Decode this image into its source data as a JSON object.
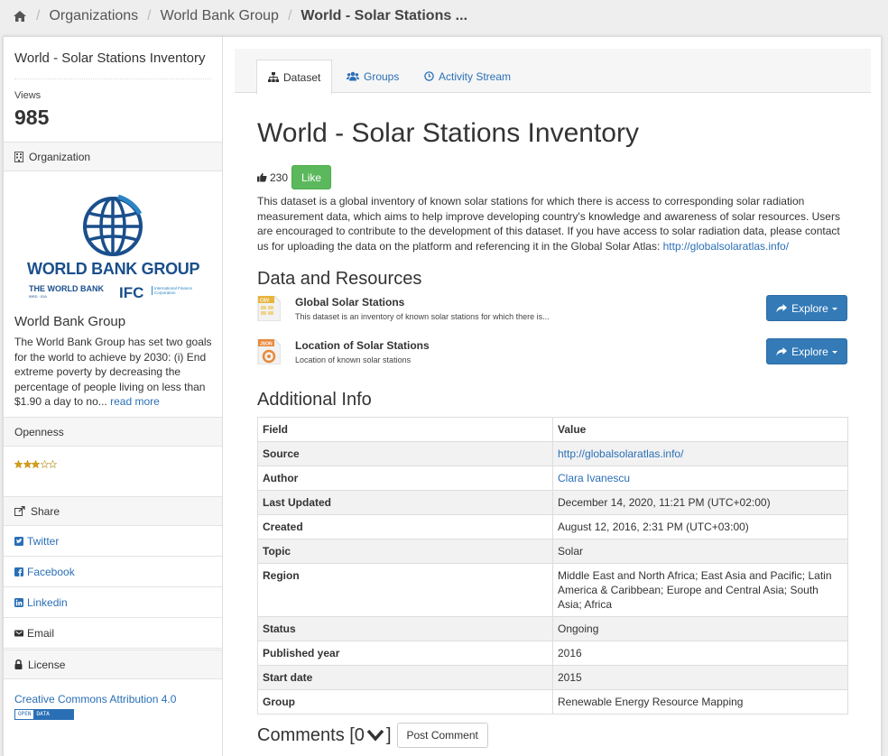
{
  "breadcrumb": {
    "items": [
      "Organizations",
      "World Bank Group"
    ],
    "current": "World - Solar Stations ..."
  },
  "sidebar": {
    "title": "World - Solar Stations Inventory",
    "views_label": "Views",
    "views_count": "985",
    "organization_heading": "Organization",
    "org_logo_text": [
      "WORLD BANK GROUP",
      "THE WORLD BANK",
      "IBRD · IDA",
      "IFC",
      "International Finance Corporation"
    ],
    "org_name": "World Bank Group",
    "org_description": "The World Bank Group has set two goals for the world to achieve by 2030: (i) End extreme poverty by decreasing the percentage of people living on less than $1.90 a day to no...",
    "read_more": "read more",
    "openness_heading": "Openness",
    "openness_stars": 3,
    "openness_max": 5,
    "share_heading": "Share",
    "share_items": [
      "Twitter",
      "Facebook",
      "Linkedin",
      "Email"
    ],
    "license_heading": "License",
    "license_link": "Creative Commons Attribution 4.0",
    "open_data_badge": [
      "OPEN",
      "DATA"
    ]
  },
  "tabs": [
    "Dataset",
    "Groups",
    "Activity Stream"
  ],
  "dataset": {
    "title": "World - Solar Stations Inventory",
    "like_count": "230",
    "like_label": "Like",
    "description": "This dataset is a global inventory of known solar stations for which there is access to corresponding solar radiation measurement data, which aims to help improve developing country's knowledge and awareness of solar resources. Users are encouraged to contribute to the development of this dataset. If you have access to solar radiation data, please contact us for uploading the data on the platform and referencing it in the Global Solar Atlas:",
    "description_link": "http://globalsolaratlas.info/"
  },
  "resources_heading": "Data and Resources",
  "resources": [
    {
      "format": "CSV",
      "name": "Global Solar Stations",
      "description": "This dataset is an inventory of known solar stations for which there is...",
      "button": "Explore"
    },
    {
      "format": "JSON",
      "name": "Location of Solar Stations",
      "description": "Location of known solar stations",
      "button": "Explore"
    }
  ],
  "additional_info": {
    "heading": "Additional Info",
    "columns": [
      "Field",
      "Value"
    ],
    "rows": [
      {
        "field": "Source",
        "value": "http://globalsolaratlas.info/",
        "link": true
      },
      {
        "field": "Author",
        "value": "Clara Ivanescu",
        "link": true
      },
      {
        "field": "Last Updated",
        "value": "December 14, 2020, 11:21 PM (UTC+02:00)",
        "link": false
      },
      {
        "field": "Created",
        "value": "August 12, 2016, 2:31 PM (UTC+03:00)",
        "link": false
      },
      {
        "field": "Topic",
        "value": "Solar",
        "link": false
      },
      {
        "field": "Region",
        "value": "Middle East and North Africa; East Asia and Pacific; Latin America & Caribbean; Europe and Central Asia; South Asia; Africa",
        "link": false
      },
      {
        "field": "Status",
        "value": "Ongoing",
        "link": false
      },
      {
        "field": "Published year",
        "value": "2016",
        "link": false
      },
      {
        "field": "Start date",
        "value": "2015",
        "link": false
      },
      {
        "field": "Group",
        "value": "Renewable Energy Resource Mapping",
        "link": false
      }
    ]
  },
  "comments": {
    "heading": "Comments [0",
    "heading_end": "]",
    "post_button": "Post Comment"
  },
  "colors": {
    "link": "#2a6fb6",
    "like_button": "#5cb85c",
    "explore_button": "#337ab7",
    "wb_blue": "#1a4f8c",
    "ifc_blue": "#2b84c6"
  },
  "icons": {
    "home": "home-icon",
    "thumbs_up": "thumbs-up-icon",
    "share": "share-icon",
    "lock": "lock-icon",
    "building": "building-icon",
    "twitter": "twitter-icon",
    "facebook": "facebook-icon",
    "linkedin": "linkedin-icon",
    "email": "envelope-icon",
    "explore": "share-arrow-icon"
  }
}
